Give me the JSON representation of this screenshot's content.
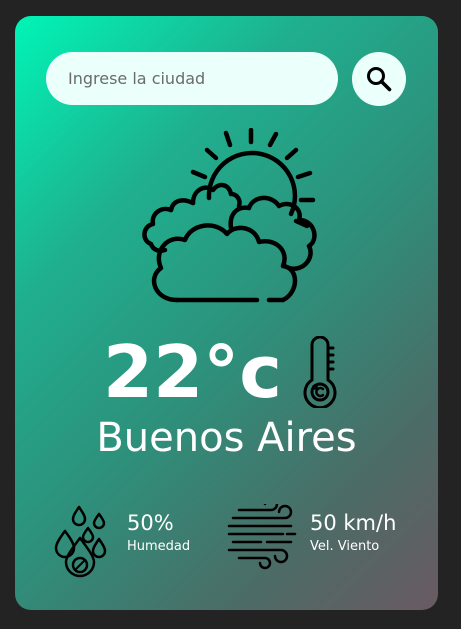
{
  "search": {
    "placeholder": "Ingrese la ciudad",
    "button_icon": "search-icon"
  },
  "weather": {
    "condition_icon": "partly-cloudy-icon",
    "temperature": "22°c",
    "temperature_icon": "thermometer-icon",
    "city": "Buenos Aires"
  },
  "details": {
    "humidity": {
      "icon": "humidity-icon",
      "value": "50%",
      "label": "Humedad"
    },
    "wind": {
      "icon": "wind-icon",
      "value": "50 km/h",
      "label": "Vel. Viento"
    }
  },
  "colors": {
    "page_background": "#232323",
    "card_gradient_start": "#00f5b6",
    "card_gradient_end": "#6a5a62",
    "input_background": "#ebfffb",
    "text": "#ffffff",
    "icon_stroke": "#000000"
  }
}
